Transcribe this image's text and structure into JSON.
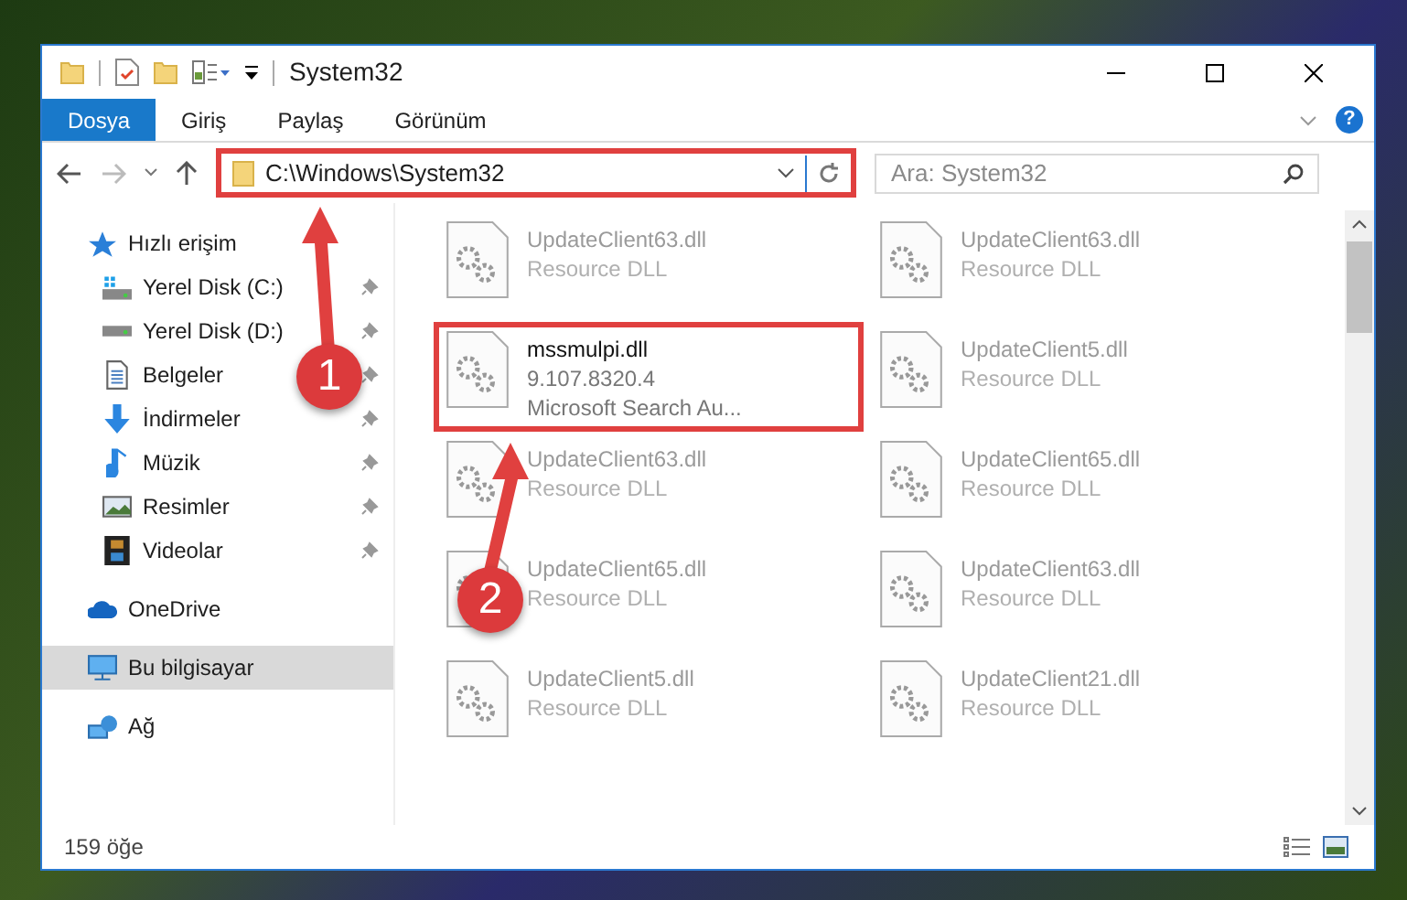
{
  "window": {
    "title": "System32"
  },
  "ribbon_tabs": [
    {
      "label": "Dosya",
      "selected": true
    },
    {
      "label": "Giriş",
      "selected": false
    },
    {
      "label": "Paylaş",
      "selected": false
    },
    {
      "label": "Görünüm",
      "selected": false
    }
  ],
  "help_button": {
    "label": "?"
  },
  "address": {
    "path": "C:\\Windows\\System32",
    "highlighted": true
  },
  "search": {
    "placeholder": "Ara: System32"
  },
  "sidebar": {
    "items": [
      {
        "label": "Hızlı erişim",
        "kind": "star",
        "selected": false,
        "children": [
          {
            "label": "Yerel Disk (C:)",
            "kind": "drive-c",
            "pinned": true,
            "selected": false
          },
          {
            "label": "Yerel Disk (D:)",
            "kind": "drive",
            "pinned": true,
            "selected": false
          },
          {
            "label": "Belgeler",
            "kind": "doc",
            "pinned": true,
            "selected": false
          },
          {
            "label": "İndirmeler",
            "kind": "download",
            "pinned": true,
            "selected": false
          },
          {
            "label": "Müzik",
            "kind": "music",
            "pinned": true,
            "selected": false
          },
          {
            "label": "Resimler",
            "kind": "picture",
            "pinned": true,
            "selected": false
          },
          {
            "label": "Videolar",
            "kind": "video",
            "pinned": true,
            "selected": false
          }
        ]
      },
      {
        "label": "OneDrive",
        "kind": "cloud",
        "selected": false
      },
      {
        "label": "Bu bilgisayar",
        "kind": "pc",
        "selected": true
      },
      {
        "label": "Ağ",
        "kind": "network",
        "selected": false
      }
    ]
  },
  "files": [
    {
      "name": "UpdateClient63.dll",
      "lines": [
        "Resource DLL"
      ],
      "highlighted": false
    },
    {
      "name": "UpdateClient63.dll",
      "lines": [
        "Resource DLL"
      ],
      "highlighted": false
    },
    {
      "name": "mssmulpi.dll",
      "lines": [
        "9.107.8320.4",
        "Microsoft Search Au..."
      ],
      "highlighted": true
    },
    {
      "name": "UpdateClient5.dll",
      "lines": [
        "Resource DLL"
      ],
      "highlighted": false
    },
    {
      "name": "UpdateClient63.dll",
      "lines": [
        "Resource DLL"
      ],
      "highlighted": false
    },
    {
      "name": "UpdateClient65.dll",
      "lines": [
        "Resource DLL"
      ],
      "highlighted": false
    },
    {
      "name": "UpdateClient65.dll",
      "lines": [
        "Resource DLL"
      ],
      "highlighted": false
    },
    {
      "name": "UpdateClient63.dll",
      "lines": [
        "Resource DLL"
      ],
      "highlighted": false
    },
    {
      "name": "UpdateClient5.dll",
      "lines": [
        "Resource DLL"
      ],
      "highlighted": false
    },
    {
      "name": "UpdateClient21.dll",
      "lines": [
        "Resource DLL"
      ],
      "highlighted": false
    }
  ],
  "annotations": [
    {
      "number": "1"
    },
    {
      "number": "2"
    }
  ],
  "status_bar": {
    "count": "159 öğe"
  }
}
